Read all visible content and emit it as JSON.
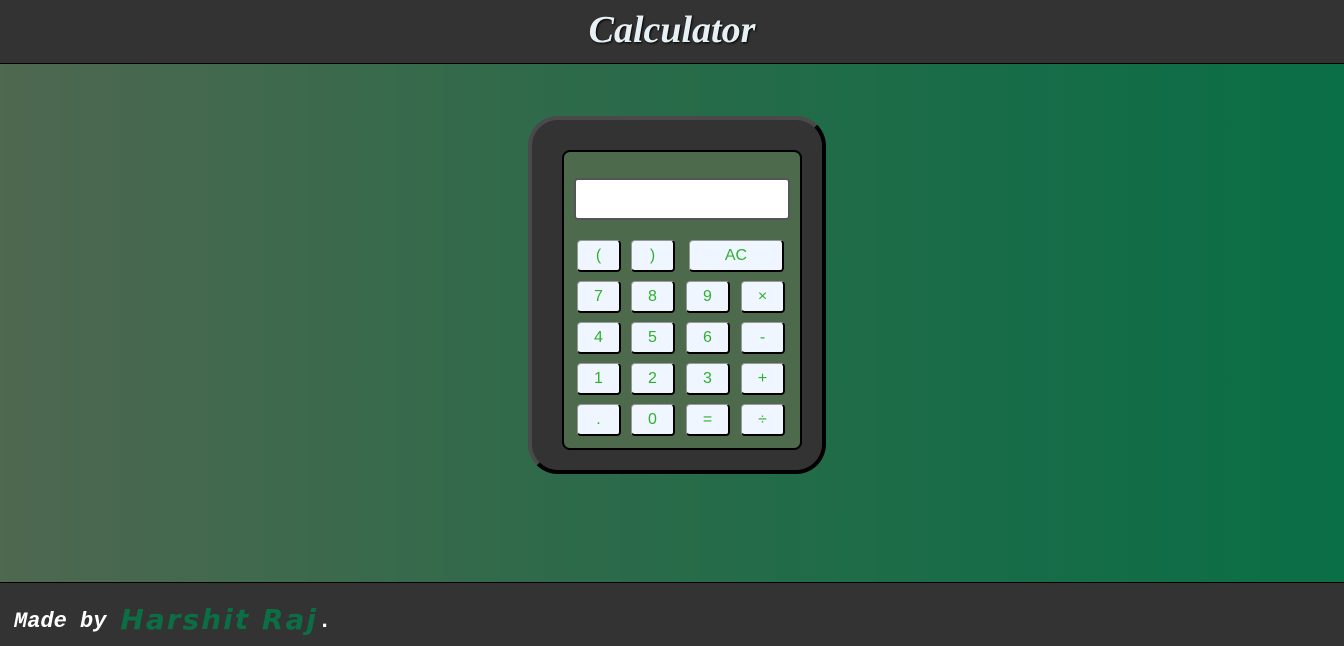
{
  "header": {
    "title": "Calculator"
  },
  "calculator": {
    "display_value": "",
    "buttons": {
      "open_paren": "(",
      "close_paren": ")",
      "all_clear": "AC",
      "seven": "7",
      "eight": "8",
      "nine": "9",
      "multiply": "×",
      "four": "4",
      "five": "5",
      "six": "6",
      "subtract": "-",
      "one": "1",
      "two": "2",
      "three": "3",
      "add": "+",
      "decimal": ".",
      "zero": "0",
      "equals": "=",
      "divide": "÷"
    }
  },
  "footer": {
    "made_by": "Made by",
    "author": "Harshit Raj",
    "period": "."
  },
  "colors": {
    "header_bg": "#333333",
    "button_text": "#2fb12f",
    "author_text": "#0c6e44",
    "calculator_face": "#4d6a4c"
  }
}
